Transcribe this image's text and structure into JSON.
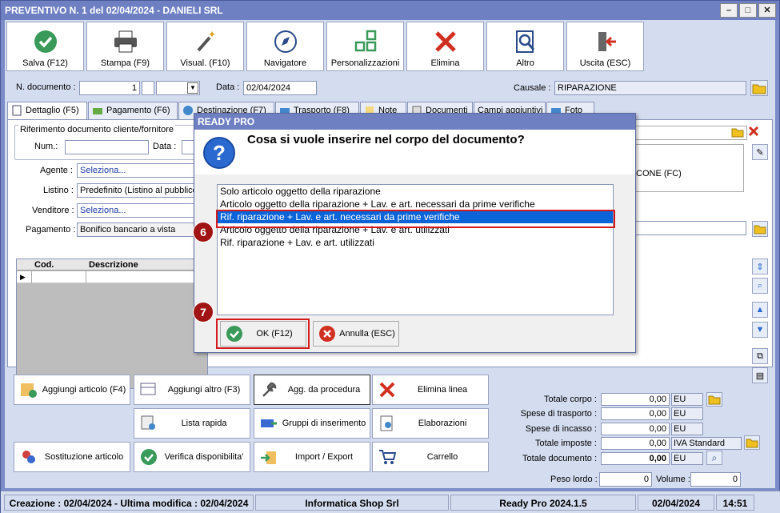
{
  "window": {
    "title": "PREVENTIVO N. 1 del 02/04/2024 - DANIELI SRL"
  },
  "toolbar": [
    {
      "label": "Salva (F12)",
      "icon": "check-icon"
    },
    {
      "label": "Stampa (F9)",
      "icon": "printer-icon"
    },
    {
      "label": "Visual. (F10)",
      "icon": "magic-wand-icon"
    },
    {
      "label": "Navigatore",
      "icon": "compass-icon"
    },
    {
      "label": "Personalizzazioni",
      "icon": "grid-icon"
    },
    {
      "label": "Elimina",
      "icon": "delete-x-icon"
    },
    {
      "label": "Altro",
      "icon": "magnifier-doc-icon"
    },
    {
      "label": "Uscita (ESC)",
      "icon": "exit-door-icon"
    }
  ],
  "header": {
    "doc_number_label": "N. documento :",
    "doc_number": "1",
    "date_label": "Data :",
    "date": "02/04/2024",
    "causale_label": "Causale :",
    "causale": "RIPARAZIONE"
  },
  "tabs": [
    "Dettaglio (F5)",
    "Pagamento (F6)",
    "Destinazione (F7)",
    "Trasporto (F8)",
    "Note",
    "Documenti",
    "Campi aggiuntivi",
    "Foto"
  ],
  "detail": {
    "rif_label": "Riferimento documento cliente/fornitore",
    "num_label": "Num.:",
    "data_label": "Data :",
    "agente_label": "Agente :",
    "agente": "Seleziona...",
    "listino_label": "Listino :",
    "listino": "Predefinito (Listino al pubblico)",
    "venditore_label": "Venditore :",
    "venditore": "Seleziona...",
    "pagamento_label": "Pagamento :",
    "pagamento": "Bonifico bancario a vista",
    "right_text": "CONE (FC)",
    "grid_cols": [
      "Cod.",
      "Descrizione"
    ]
  },
  "bottom_buttons": [
    {
      "label": "Aggiungi articolo (F4)",
      "icon": "add-box-icon"
    },
    {
      "label": "Aggiungi altro (F3)",
      "icon": "add-table-icon"
    },
    {
      "label": "Agg. da procedura",
      "icon": "wrench-icon"
    },
    {
      "label": "Elimina linea",
      "icon": "delete-x-icon"
    },
    {
      "label": "Lista rapida",
      "icon": "quick-list-icon"
    },
    {
      "label": "Gruppi di inserimento",
      "icon": "groups-icon"
    },
    {
      "label": "Elaborazioni",
      "icon": "gear-doc-icon"
    },
    {
      "label": "Sostituzione articolo",
      "icon": "swap-icon"
    },
    {
      "label": "Verifica disponibilita'",
      "icon": "check-icon"
    },
    {
      "label": "Import / Export",
      "icon": "import-export-icon"
    },
    {
      "label": "Carrello",
      "icon": "cart-icon"
    }
  ],
  "totals": [
    {
      "label": "Totale corpo :",
      "value": "0,00",
      "unit": "EU"
    },
    {
      "label": "Spese di trasporto :",
      "value": "0,00",
      "unit": "EU"
    },
    {
      "label": "Spese di incasso :",
      "value": "0,00",
      "unit": "EU"
    },
    {
      "label": "Totale imposte :",
      "value": "0,00",
      "unit": "IVA Standard"
    },
    {
      "label": "Totale documento :",
      "value": "0,00",
      "unit": "EU"
    }
  ],
  "weight": {
    "peso_label": "Peso lordo :",
    "peso": "0",
    "volume_label": "Volume :",
    "volume": "0"
  },
  "status": {
    "created": "Creazione : 02/04/2024 - Ultima modifica : 02/04/2024",
    "company": "Informatica Shop Srl",
    "version": "Ready Pro 2024.1.5",
    "date": "02/04/2024",
    "time": "14:51"
  },
  "dialog": {
    "title": "READY PRO",
    "question": "Cosa si vuole inserire nel corpo del documento?",
    "options": [
      "Solo articolo oggetto della riparazione",
      "Articolo oggetto della riparazione + Lav. e art. necessari da prime verifiche",
      "Rif. riparazione + Lav. e art. necessari da prime verifiche",
      "Articolo oggetto della riparazione + Lav. e art. utilizzati",
      "Rif. riparazione + Lav. e art. utilizzati"
    ],
    "selected_index": 2,
    "ok_label": "OK (F12)",
    "cancel_label": "Annulla (ESC)"
  },
  "annotations": {
    "step_6": "6",
    "step_7": "7"
  },
  "colors": {
    "title_bar": "#6e80c2",
    "selection": "#0a64d8",
    "highlight_box": "#d41a1a"
  }
}
